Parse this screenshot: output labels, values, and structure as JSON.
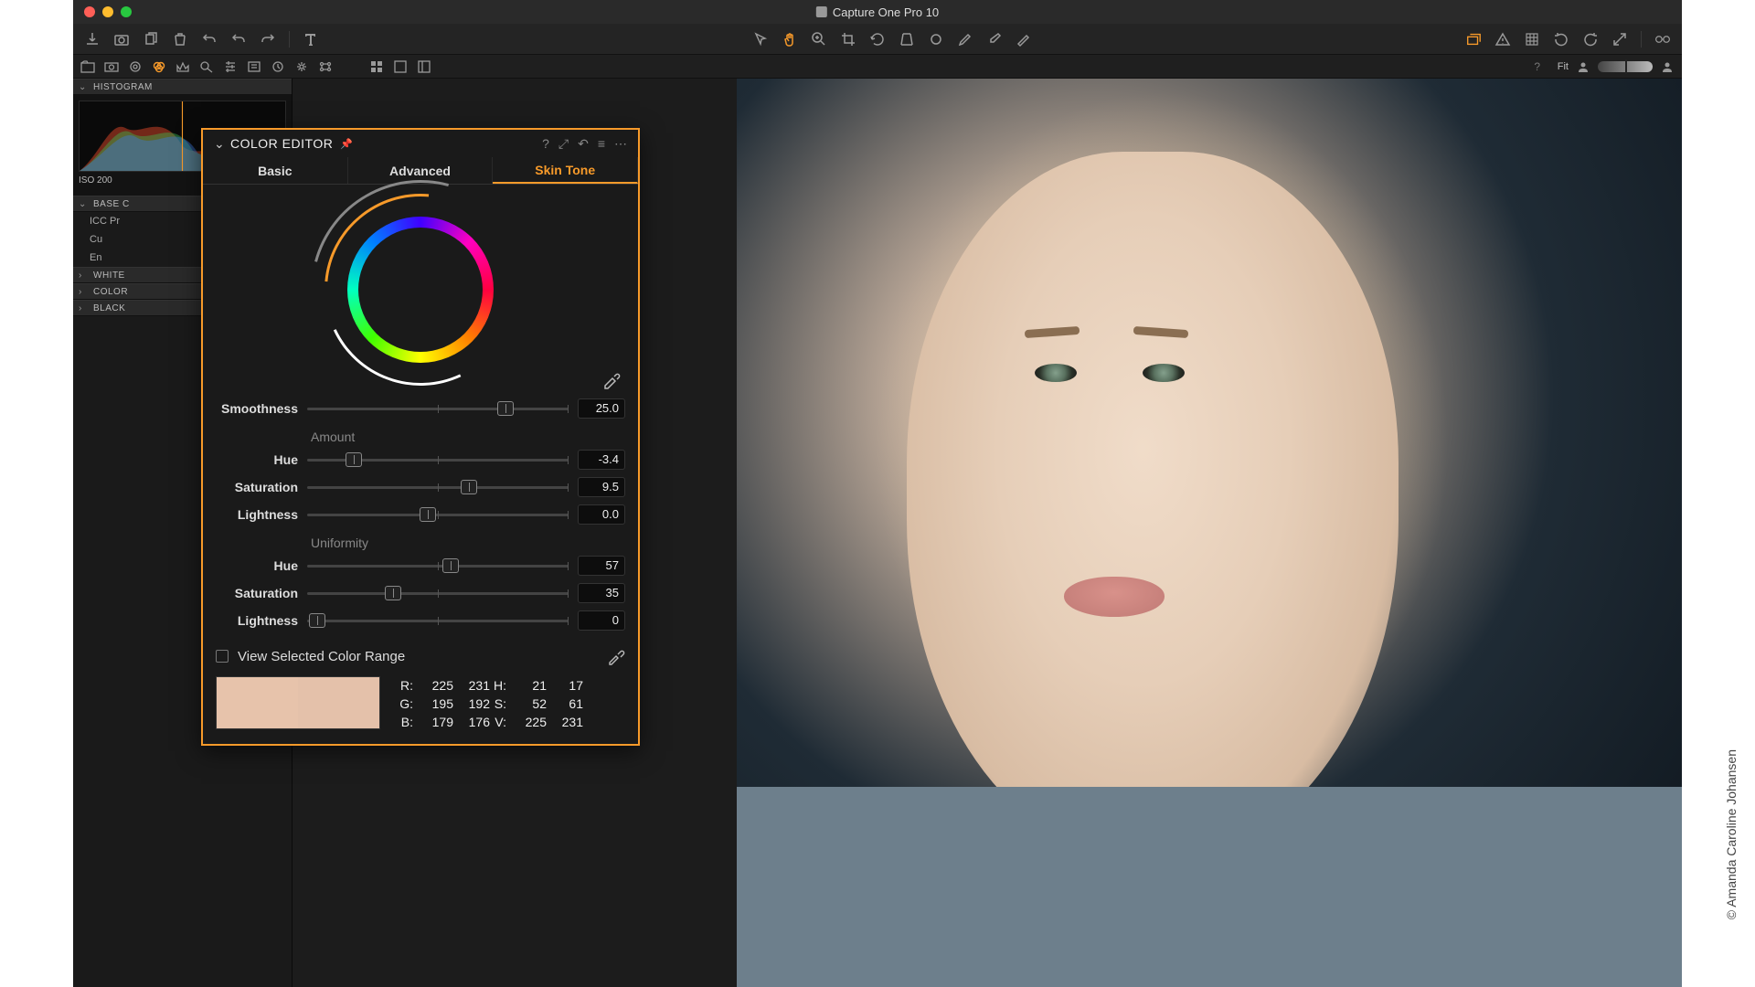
{
  "window": {
    "title": "Capture One Pro 10"
  },
  "histogram": {
    "label": "HISTOGRAM",
    "iso": "ISO 200"
  },
  "basechar": {
    "label": "BASE C",
    "items": [
      "ICC Pr",
      "Cu",
      "En"
    ]
  },
  "collapsed_panels": [
    "WHITE",
    "COLOR",
    "BLACK"
  ],
  "fit_label": "Fit",
  "color_editor": {
    "title": "COLOR EDITOR",
    "tabs": {
      "basic": "Basic",
      "advanced": "Advanced",
      "skin": "Skin Tone"
    },
    "smoothness": {
      "label": "Smoothness",
      "value": "25.0",
      "pos": 76
    },
    "amount": {
      "label": "Amount",
      "hue": {
        "label": "Hue",
        "value": "-3.4",
        "pos": 18
      },
      "saturation": {
        "label": "Saturation",
        "value": "9.5",
        "pos": 62
      },
      "lightness": {
        "label": "Lightness",
        "value": "0.0",
        "pos": 46
      }
    },
    "uniformity": {
      "label": "Uniformity",
      "hue": {
        "label": "Hue",
        "value": "57",
        "pos": 55
      },
      "saturation": {
        "label": "Saturation",
        "value": "35",
        "pos": 33
      },
      "lightness": {
        "label": "Lightness",
        "value": "0",
        "pos": 4
      }
    },
    "view_range": "View Selected Color Range",
    "swatch1": "#e7c3ab",
    "swatch2": "#e4c1aa",
    "readout": {
      "r1": "225",
      "r2": "231",
      "g1": "195",
      "g2": "192",
      "b1": "179",
      "b2": "176",
      "h1": "21",
      "h2": "17",
      "s1": "52",
      "s2": "61",
      "v1": "225",
      "v2": "231"
    }
  },
  "credit": "© Amanda Caroline Johansen"
}
